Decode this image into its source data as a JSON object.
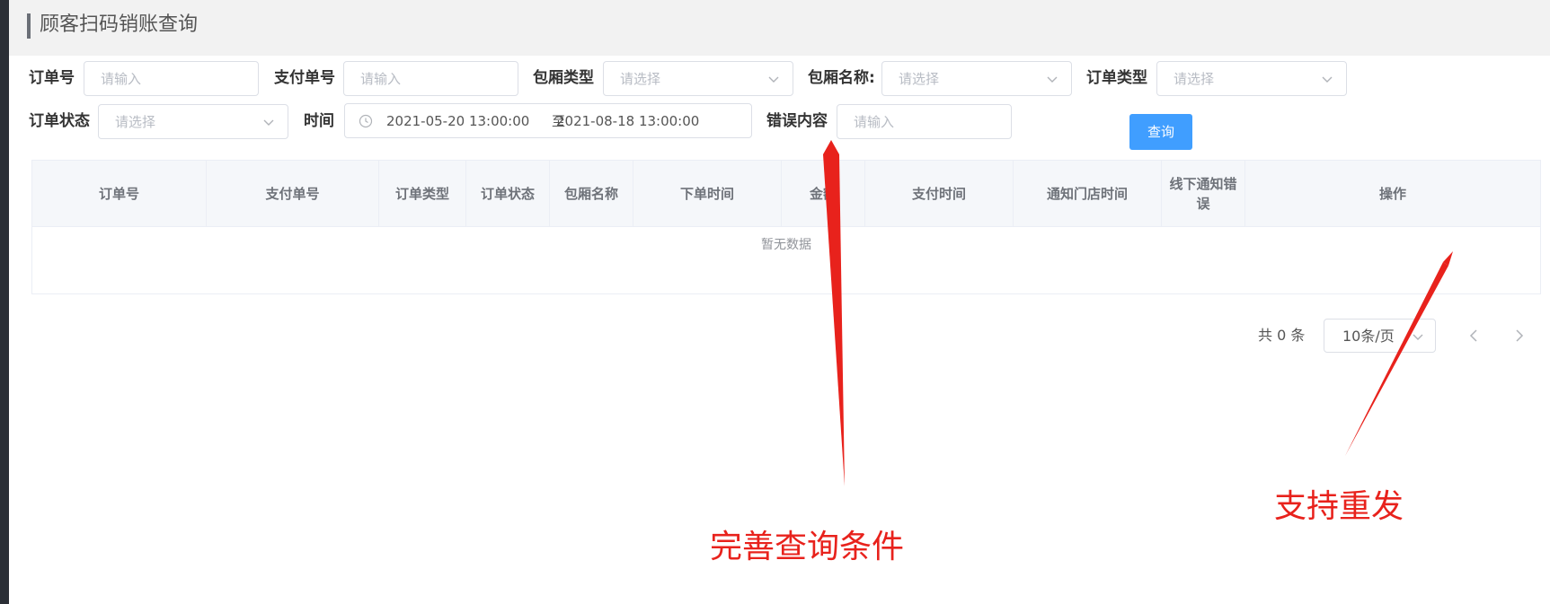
{
  "header": {
    "title": "顾客扫码销账查询"
  },
  "filters": {
    "order_no": {
      "label": "订单号",
      "placeholder": "请输入"
    },
    "pay_no": {
      "label": "支付单号",
      "placeholder": "请输入"
    },
    "room_type": {
      "label": "包厢类型",
      "placeholder": "请选择"
    },
    "room_name": {
      "label": "包厢名称:",
      "placeholder": "请选择"
    },
    "order_type": {
      "label": "订单类型",
      "placeholder": "请选择"
    },
    "order_status": {
      "label": "订单状态",
      "placeholder": "请选择"
    },
    "time": {
      "label": "时间",
      "start": "2021-05-20 13:00:00",
      "separator": "至",
      "end": "2021-08-18 13:00:00"
    },
    "error_content": {
      "label": "错误内容",
      "placeholder": "请输入"
    },
    "query_button": "查询"
  },
  "table": {
    "columns": [
      "订单号",
      "支付单号",
      "订单类型",
      "订单状态",
      "包厢名称",
      "下单时间",
      "金额",
      "支付时间",
      "通知门店时间",
      "线下通知错误",
      "操作"
    ],
    "empty_text": "暂无数据"
  },
  "pagination": {
    "total": "共 0 条",
    "page_size": "10条/页"
  },
  "annotations": {
    "left": "完善查询条件",
    "right": "支持重发"
  },
  "colors": {
    "primary": "#409eff",
    "annotation": "#e8221c"
  },
  "icons": [
    "chevron-down-icon",
    "clock-icon",
    "chevron-left-icon",
    "chevron-right-icon"
  ]
}
